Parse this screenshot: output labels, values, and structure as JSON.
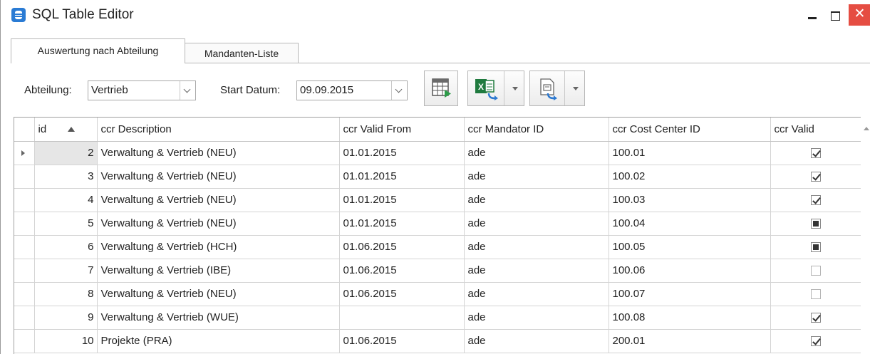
{
  "window": {
    "title": "SQL Table Editor",
    "close_glyph": "✕"
  },
  "tabs": [
    {
      "label": "Auswertung nach Abteilung",
      "active": true
    },
    {
      "label": "Mandanten-Liste",
      "active": false
    }
  ],
  "filters": {
    "department_label": "Abteilung:",
    "department_value": "Vertrieb",
    "start_date_label": "Start Datum:",
    "start_date_value": "09.09.2015"
  },
  "toolbar": {
    "icons": [
      "table-run-icon",
      "excel-export-icon",
      "document-export-icon"
    ]
  },
  "table": {
    "columns": [
      "id",
      "ccr Description",
      "ccr Valid From",
      "ccr Mandator ID",
      "ccr Cost Center ID",
      "ccr Valid"
    ],
    "sort": {
      "column": "id",
      "direction": "ascending"
    },
    "rows": [
      {
        "id": "2",
        "description": "Verwaltung & Vertrieb (NEU)",
        "valid_from": "01.01.2015",
        "mandator": "ade",
        "cost_center": "100.01",
        "valid": "checked"
      },
      {
        "id": "3",
        "description": "Verwaltung & Vertrieb (NEU)",
        "valid_from": "01.01.2015",
        "mandator": "ade",
        "cost_center": "100.02",
        "valid": "checked"
      },
      {
        "id": "4",
        "description": "Verwaltung & Vertrieb (NEU)",
        "valid_from": "01.01.2015",
        "mandator": "ade",
        "cost_center": "100.03",
        "valid": "checked"
      },
      {
        "id": "5",
        "description": "Verwaltung & Vertrieb (NEU)",
        "valid_from": "01.01.2015",
        "mandator": "ade",
        "cost_center": "100.04",
        "valid": "indeterminate"
      },
      {
        "id": "6",
        "description": "Verwaltung & Vertrieb (HCH)",
        "valid_from": "01.06.2015",
        "mandator": "ade",
        "cost_center": "100.05",
        "valid": "indeterminate"
      },
      {
        "id": "7",
        "description": "Verwaltung & Vertrieb (IBE)",
        "valid_from": "01.06.2015",
        "mandator": "ade",
        "cost_center": "100.06",
        "valid": "unchecked"
      },
      {
        "id": "8",
        "description": "Verwaltung & Vertrieb (NEU)",
        "valid_from": "01.06.2015",
        "mandator": "ade",
        "cost_center": "100.07",
        "valid": "unchecked"
      },
      {
        "id": "9",
        "description": "Verwaltung & Vertrieb (WUE)",
        "valid_from": "",
        "mandator": "ade",
        "cost_center": "100.08",
        "valid": "checked"
      },
      {
        "id": "10",
        "description": "Projekte (PRA)",
        "valid_from": "01.06.2015",
        "mandator": "ade",
        "cost_center": "200.01",
        "valid": "checked"
      }
    ],
    "selected_row": 0
  }
}
